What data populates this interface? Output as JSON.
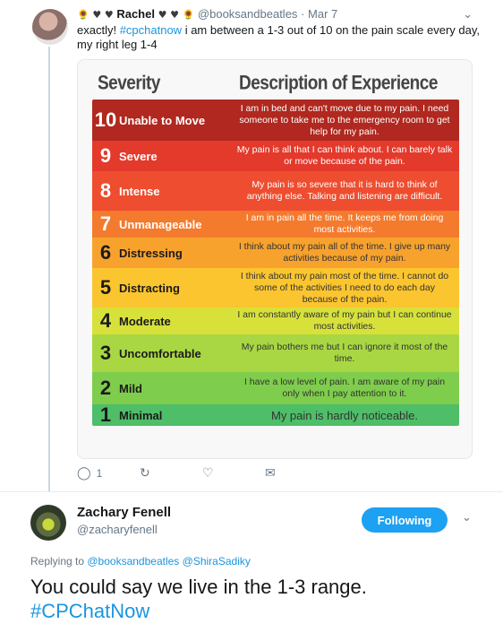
{
  "tweet1": {
    "name_prefix_emojis": [
      "🌻",
      "♥",
      "♥"
    ],
    "name": "Rachel",
    "name_suffix_emojis": [
      "♥",
      "♥",
      "🌻"
    ],
    "handle": "@booksandbeatles",
    "separator": "·",
    "date": "Mar 7",
    "text_before": "exactly! ",
    "hashtag": "#cpchatnow",
    "text_after": " i am between a 1-3 out of 10 on the pain scale every day, my right leg 1-4",
    "card": {
      "col_severity": "Severity",
      "col_description": "Description of Experience",
      "rows": [
        {
          "num": "10",
          "label": "Unable to Move",
          "desc": "I am in bed and can't move due to my pain. I need someone to take me to the emergency room to get help for my pain.",
          "color": "#b0281f",
          "light": false
        },
        {
          "num": "9",
          "label": "Severe",
          "desc": "My pain is all that I can think about. I can barely talk or move because of the pain.",
          "color": "#e33a2c",
          "light": false
        },
        {
          "num": "8",
          "label": "Intense",
          "desc": "My pain is so severe that it is hard to think of anything else. Talking and listening are difficult.",
          "color": "#ee4d2f",
          "light": false
        },
        {
          "num": "7",
          "label": "Unmanageable",
          "desc": "I am in pain all the time. It keeps me from doing most activities.",
          "color": "#f47a2d",
          "light": false
        },
        {
          "num": "6",
          "label": "Distressing",
          "desc": "I think about my pain all of the time. I give up many activities because of my pain.",
          "color": "#f8a22e",
          "light": true
        },
        {
          "num": "5",
          "label": "Distracting",
          "desc": "I think about my pain most of the time. I cannot do some of the activities I need to do each day because of the pain.",
          "color": "#fbc52f",
          "light": true
        },
        {
          "num": "4",
          "label": "Moderate",
          "desc": "I am constantly aware of my pain but I can continue most activities.",
          "color": "#d7e13a",
          "light": true
        },
        {
          "num": "3",
          "label": "Uncomfortable",
          "desc": "My pain bothers me but I can ignore it most of the time.",
          "color": "#a9d743",
          "light": true
        },
        {
          "num": "2",
          "label": "Mild",
          "desc": "I have a low level of pain. I am aware of my pain only when I pay attention to it.",
          "color": "#7fcd4c",
          "light": true
        },
        {
          "num": "1",
          "label": "Minimal",
          "desc": "My pain is hardly noticeable.",
          "color": "#4fbe68",
          "light": true
        }
      ]
    },
    "actions": {
      "reply_count": "1",
      "retweet_count": "",
      "like_count": ""
    }
  },
  "tweet2": {
    "name": "Zachary Fenell",
    "handle": "@zacharyfenell",
    "follow_label": "Following",
    "replying_prefix": "Replying to ",
    "replying_to_1": "@booksandbeatles",
    "replying_to_2": "@ShiraSadiky",
    "text_line1": "You could say we live in the 1-3 range.",
    "hashtag": "#CPChatNow"
  },
  "icons": {
    "reply": "reply-icon",
    "retweet": "retweet-icon",
    "like": "heart-icon",
    "message": "direct-message-icon",
    "caret": "chevron-down-icon"
  },
  "colors": {
    "link": "#1b95e0",
    "follow_button": "#1da1f2",
    "secondary_text": "#657786"
  }
}
